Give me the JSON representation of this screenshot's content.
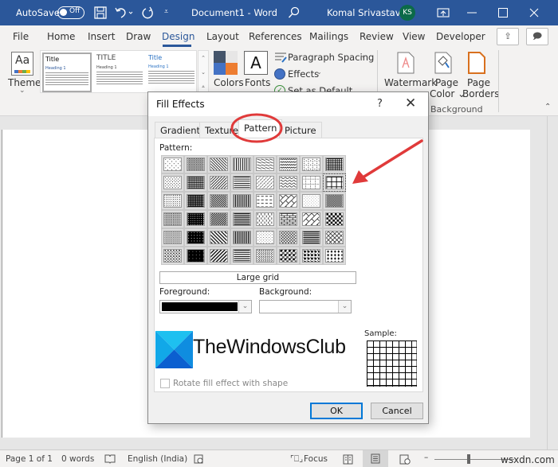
{
  "titlebar": {
    "autosave_label": "AutoSave",
    "autosave_state": "Off",
    "document_title": "Document1  -  Word",
    "user_name": "Komal Srivastava",
    "user_initials": "KS"
  },
  "menu_tabs": [
    "File",
    "Home",
    "Insert",
    "Draw",
    "Design",
    "Layout",
    "References",
    "Mailings",
    "Review",
    "View",
    "Developer"
  ],
  "active_tab": "Design",
  "ribbon": {
    "themes_label": "Themes",
    "style_thumbs": [
      {
        "title": "Title",
        "heading": "Heading 1"
      },
      {
        "title": "TITLE",
        "heading": "Heading 1"
      },
      {
        "title": "Title",
        "heading": "Heading 1"
      }
    ],
    "colors_label": "Colors",
    "fonts_label": "Fonts",
    "paragraph_spacing_label": "Paragraph Spacing",
    "effects_label": "Effects",
    "set_default_label": "Set as Default",
    "watermark_label": "Watermark",
    "page_color_label": "Page Color",
    "page_borders_label": "Page Borders",
    "background_group_label": "Background"
  },
  "dialog": {
    "title": "Fill Effects",
    "help": "?",
    "close": "✕",
    "tabs": [
      "Gradient",
      "Texture",
      "Pattern",
      "Picture"
    ],
    "active_tab": "Pattern",
    "pattern_label": "Pattern:",
    "selected_pattern_name": "Large grid",
    "foreground_label": "Foreground:",
    "foreground_color": "#000000",
    "background_label": "Background:",
    "background_color": "#ffffff",
    "sample_label": "Sample:",
    "rotate_label": "Rotate fill effect with shape",
    "rotate_checked": false,
    "ok_label": "OK",
    "cancel_label": "Cancel",
    "watermark_logo_text": "TheWindowsClub"
  },
  "statusbar": {
    "page": "Page 1 of 1",
    "words": "0 words",
    "language": "English (India)",
    "focus_label": "Focus",
    "watermark_text": "wsxdn.com"
  },
  "colors": {
    "titlebar_blue": "#2b579a",
    "annotation_red": "#e03a3a",
    "avatar_green": "#0b6a48",
    "ok_border": "#0078d7"
  }
}
